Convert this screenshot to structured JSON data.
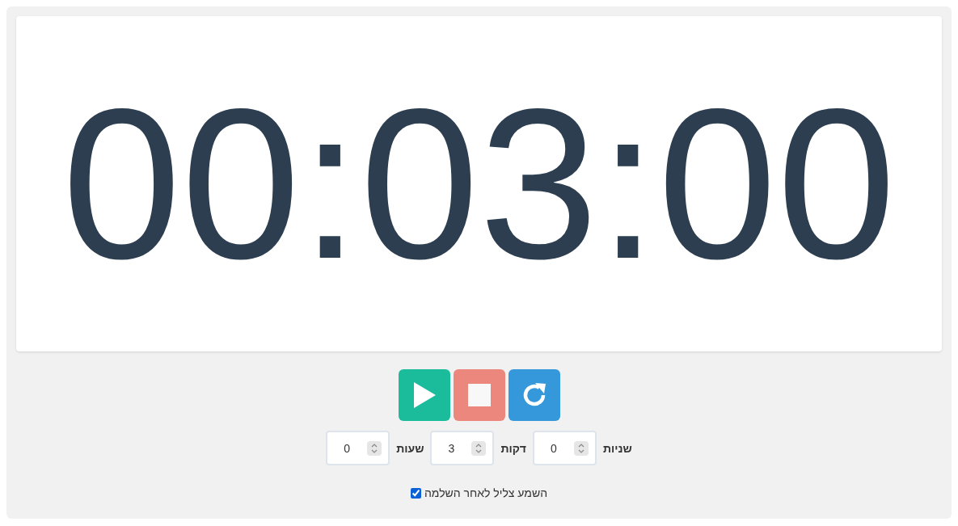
{
  "timer": {
    "display": "00:03:00"
  },
  "controls": [
    {
      "kind": "play"
    },
    {
      "kind": "stop"
    },
    {
      "kind": "reset"
    }
  ],
  "fields": [
    {
      "label": "שניות",
      "value": "0"
    },
    {
      "label": "דקות",
      "value": "3"
    },
    {
      "label": "שעות",
      "value": "0"
    }
  ],
  "sound_option": {
    "label": "השמע צליל לאחר השלמה",
    "checked": true
  }
}
